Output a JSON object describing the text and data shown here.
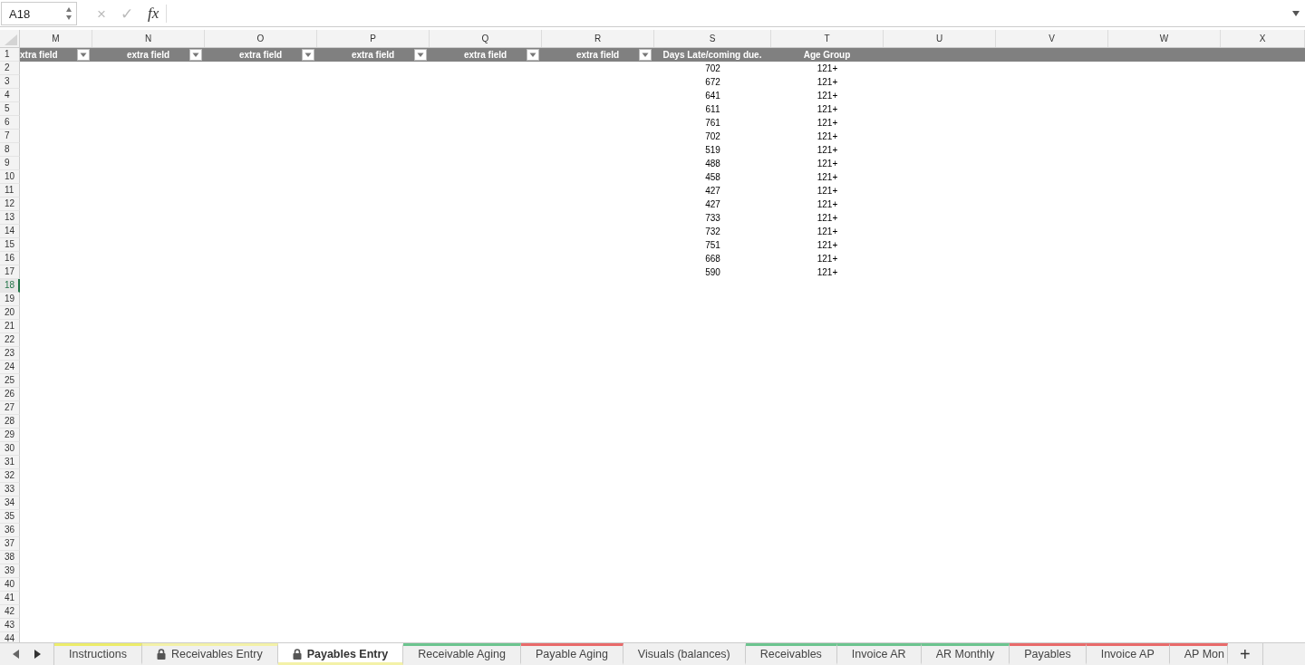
{
  "formula_bar": {
    "name_box": "A18",
    "cancel": "×",
    "enter": "✓",
    "function": "fx"
  },
  "columns": [
    {
      "letter": "M"
    },
    {
      "letter": "N"
    },
    {
      "letter": "O"
    },
    {
      "letter": "P"
    },
    {
      "letter": "Q"
    },
    {
      "letter": "R"
    },
    {
      "letter": "S"
    },
    {
      "letter": "T"
    },
    {
      "letter": "U"
    },
    {
      "letter": "V"
    },
    {
      "letter": "W"
    },
    {
      "letter": "X"
    }
  ],
  "header_row": {
    "number": "1",
    "cells": [
      {
        "text": "xtra field",
        "filter": true
      },
      {
        "text": "extra field",
        "filter": true
      },
      {
        "text": "extra field",
        "filter": true
      },
      {
        "text": "extra field",
        "filter": true
      },
      {
        "text": "extra field",
        "filter": true
      },
      {
        "text": "extra field",
        "filter": true
      },
      {
        "text": "Days Late/coming due.",
        "filter": false
      },
      {
        "text": "Age Group",
        "filter": false
      },
      {
        "filter": false
      },
      {
        "filter": false
      },
      {
        "filter": false
      },
      {
        "filter": false
      }
    ]
  },
  "rows": [
    {
      "number": "2",
      "selected": false,
      "days_late": "702",
      "age_group": "121+"
    },
    {
      "number": "3",
      "selected": false,
      "days_late": "672",
      "age_group": "121+"
    },
    {
      "number": "4",
      "selected": false,
      "days_late": "641",
      "age_group": "121+"
    },
    {
      "number": "5",
      "selected": false,
      "days_late": "611",
      "age_group": "121+"
    },
    {
      "number": "6",
      "selected": false,
      "days_late": "761",
      "age_group": "121+"
    },
    {
      "number": "7",
      "selected": false,
      "days_late": "702",
      "age_group": "121+"
    },
    {
      "number": "8",
      "selected": false,
      "days_late": "519",
      "age_group": "121+"
    },
    {
      "number": "9",
      "selected": false,
      "days_late": "488",
      "age_group": "121+"
    },
    {
      "number": "10",
      "selected": false,
      "days_late": "458",
      "age_group": "121+"
    },
    {
      "number": "11",
      "selected": false,
      "days_late": "427",
      "age_group": "121+"
    },
    {
      "number": "12",
      "selected": false,
      "days_late": "427",
      "age_group": "121+"
    },
    {
      "number": "13",
      "selected": false,
      "days_late": "733",
      "age_group": "121+"
    },
    {
      "number": "14",
      "selected": false,
      "days_late": "732",
      "age_group": "121+"
    },
    {
      "number": "15",
      "selected": false,
      "days_late": "751",
      "age_group": "121+"
    },
    {
      "number": "16",
      "selected": false,
      "days_late": "668",
      "age_group": "121+"
    },
    {
      "number": "17",
      "selected": false,
      "days_late": "590",
      "age_group": "121+"
    },
    {
      "number": "18",
      "selected": true
    },
    {
      "number": "19",
      "selected": false
    },
    {
      "number": "20",
      "selected": false
    },
    {
      "number": "21",
      "selected": false
    },
    {
      "number": "22",
      "selected": false
    },
    {
      "number": "23",
      "selected": false
    },
    {
      "number": "24",
      "selected": false
    },
    {
      "number": "25",
      "selected": false
    },
    {
      "number": "26",
      "selected": false
    },
    {
      "number": "27",
      "selected": false
    },
    {
      "number": "28",
      "selected": false
    },
    {
      "number": "29",
      "selected": false
    },
    {
      "number": "30",
      "selected": false
    },
    {
      "number": "31",
      "selected": false
    },
    {
      "number": "32",
      "selected": false
    },
    {
      "number": "33",
      "selected": false
    },
    {
      "number": "34",
      "selected": false
    },
    {
      "number": "35",
      "selected": false
    },
    {
      "number": "36",
      "selected": false
    },
    {
      "number": "37",
      "selected": false
    },
    {
      "number": "38",
      "selected": false
    },
    {
      "number": "39",
      "selected": false
    },
    {
      "number": "40",
      "selected": false
    },
    {
      "number": "41",
      "selected": false
    },
    {
      "number": "42",
      "selected": false
    },
    {
      "number": "43",
      "selected": false
    },
    {
      "number": "44",
      "selected": false
    }
  ],
  "sheet_tabs": [
    {
      "label": "Instructions",
      "locked": false,
      "selected": false,
      "color": "#ecec6a"
    },
    {
      "label": "Receivables Entry",
      "locked": true,
      "selected": false,
      "color": "#f3f1a8"
    },
    {
      "label": "Payables Entry",
      "locked": true,
      "selected": true,
      "color": "#f3f1a8"
    },
    {
      "label": "Receivable Aging",
      "locked": false,
      "selected": false,
      "color": "#6cc48f"
    },
    {
      "label": "Payable Aging",
      "locked": false,
      "selected": false,
      "color": "#e86a6a"
    },
    {
      "label": "Visuals (balances)",
      "locked": false,
      "selected": false
    },
    {
      "label": "Receivables",
      "locked": false,
      "selected": false,
      "color": "#6cc48f"
    },
    {
      "label": "Invoice AR",
      "locked": false,
      "selected": false,
      "color": "#6cc48f"
    },
    {
      "label": "AR Monthly",
      "locked": false,
      "selected": false,
      "color": "#6cc48f"
    },
    {
      "label": "Payables",
      "locked": false,
      "selected": false,
      "color": "#e86a6a"
    },
    {
      "label": "Invoice AP",
      "locked": false,
      "selected": false,
      "color": "#e86a6a"
    },
    {
      "label": "AP Mon",
      "locked": false,
      "selected": false,
      "color": "#e86a6a"
    }
  ],
  "add_sheet": "+"
}
